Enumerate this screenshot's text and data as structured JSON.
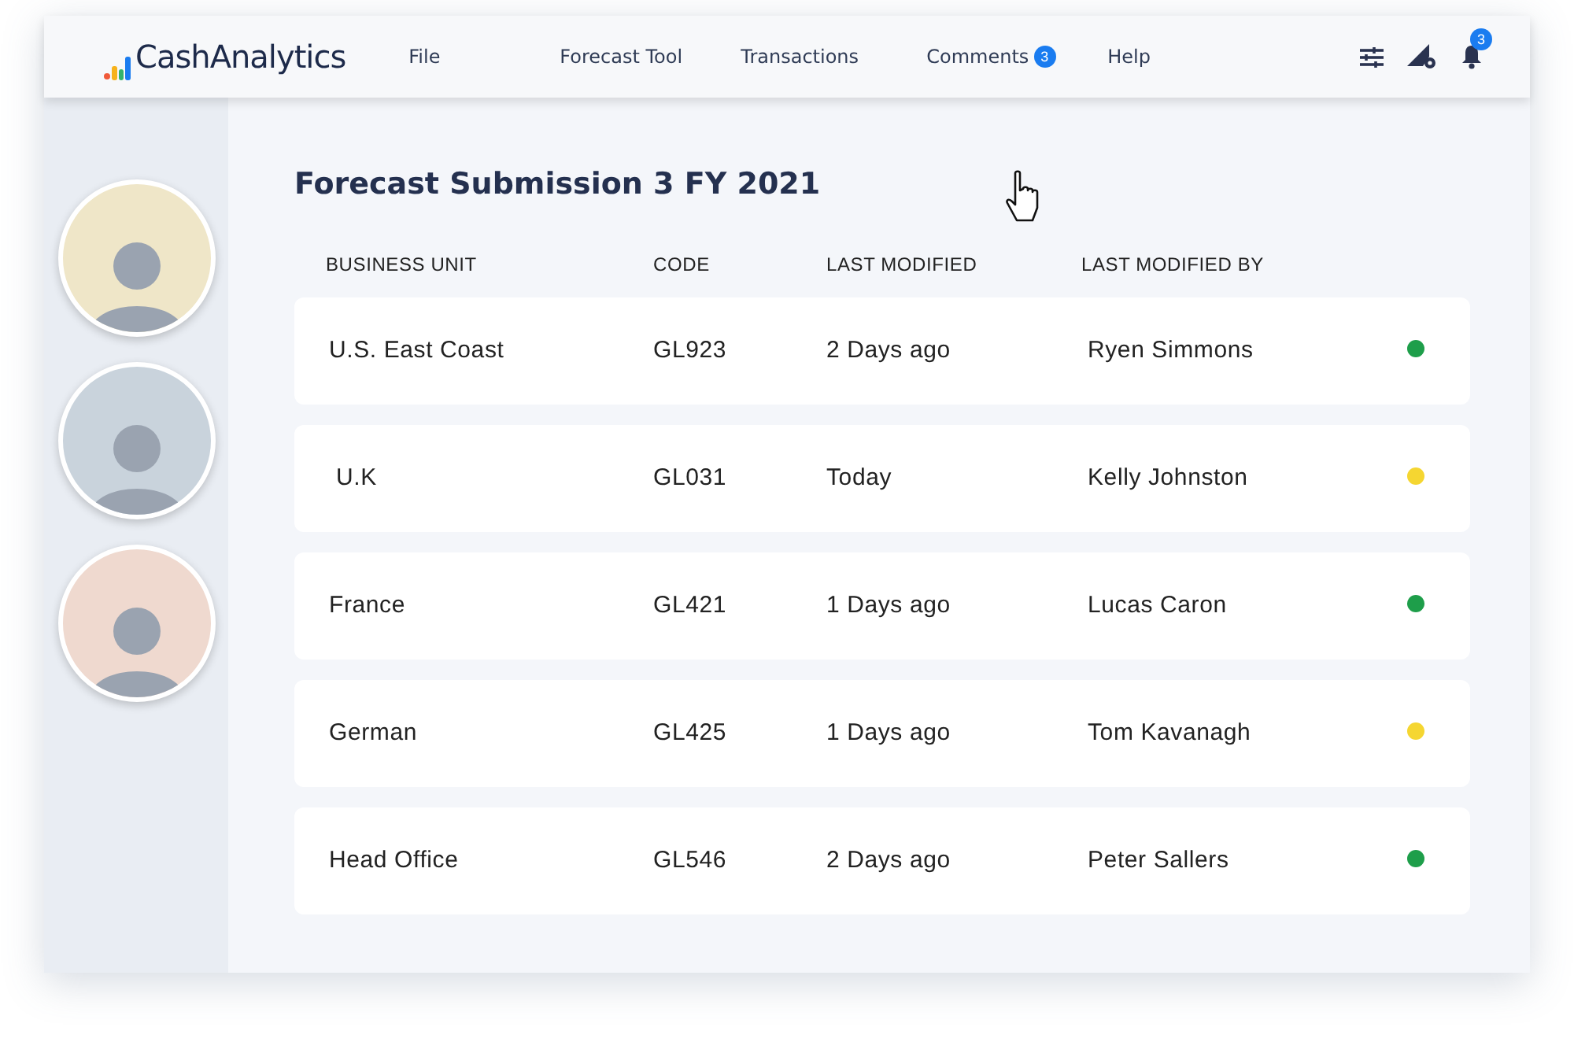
{
  "navbar": {
    "logo": "CashAnalytics",
    "menu": [
      {
        "label": "File"
      },
      {
        "label": "Forecast Tool"
      },
      {
        "label": "Transactions"
      },
      {
        "label": "Comments",
        "badge": "3"
      },
      {
        "label": "Help"
      }
    ],
    "notification_badge": "3"
  },
  "sidebar": {
    "avatars": [
      {
        "color": "#efe6c8"
      },
      {
        "color": "#c9d3dc"
      },
      {
        "color": "#efd9cf"
      }
    ]
  },
  "title": "Forecast Submission 3 FY 2021",
  "table": {
    "columns": [
      "BUSINESS UNIT",
      "CODE",
      "LAST MODIFIED",
      "LAST MODIFIED BY"
    ],
    "rows": [
      {
        "cells": [
          "U.S. East Coast",
          "GL923",
          "2 Days ago",
          "Ryen Simmons"
        ],
        "color": "#1e9e4a"
      },
      {
        "cells": [
          " U.K",
          "GL031",
          "Today",
          "Kelly Johnston"
        ],
        "color": "#f5d631"
      },
      {
        "cells": [
          "France",
          "GL421",
          "1 Days ago",
          "Lucas Caron"
        ],
        "color": "#1e9e4a"
      },
      {
        "cells": [
          "German",
          "GL425",
          "1 Days ago",
          "Tom Kavanagh"
        ],
        "color": "#f5d631"
      },
      {
        "cells": [
          "Head Office",
          "GL546",
          "2 Days ago",
          "Peter Sallers"
        ],
        "color": "#1e9e4a"
      }
    ]
  }
}
